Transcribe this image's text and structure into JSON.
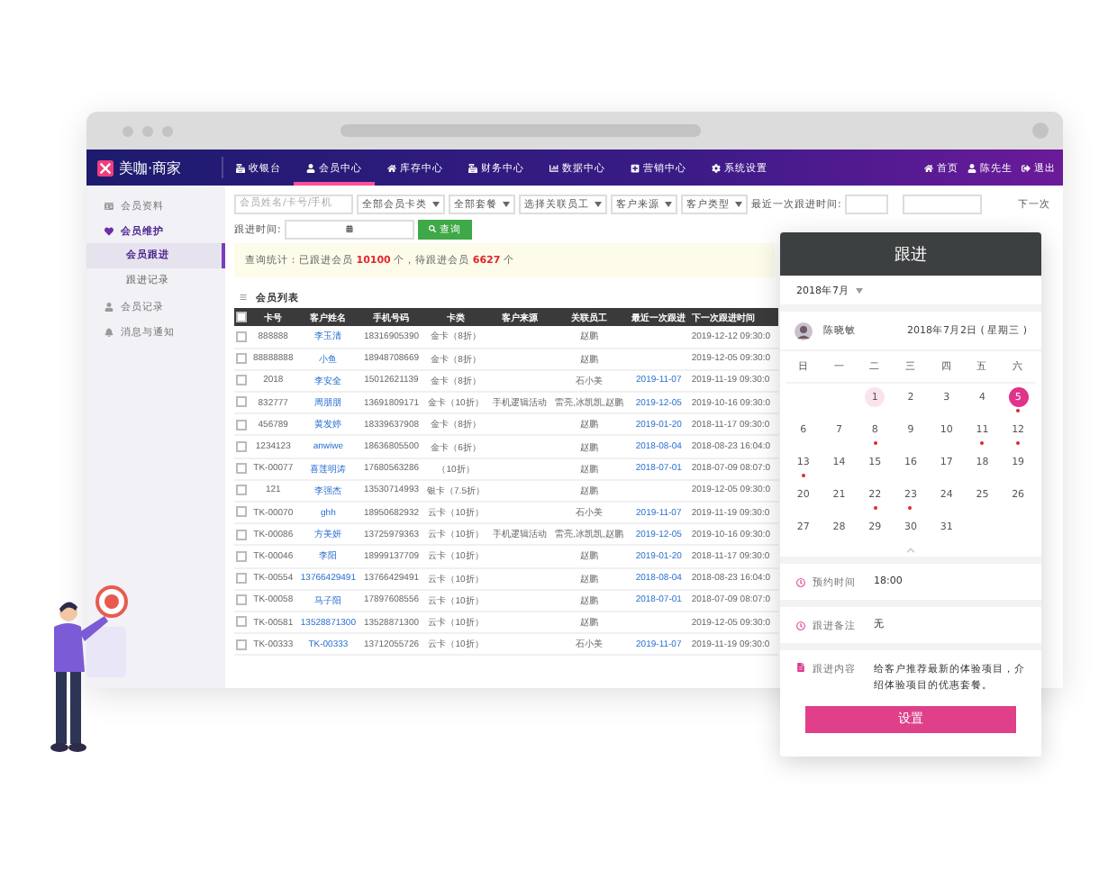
{
  "logo": {
    "brand": "美咖",
    "suffix": "·商家"
  },
  "nav": [
    {
      "label": "收银台",
      "selected": false
    },
    {
      "label": "会员中心",
      "selected": true
    },
    {
      "label": "库存中心",
      "selected": false
    },
    {
      "label": "财务中心",
      "selected": false
    },
    {
      "label": "数据中心",
      "selected": false
    },
    {
      "label": "营销中心",
      "selected": false
    },
    {
      "label": "系统设置",
      "selected": false
    }
  ],
  "nav_right": [
    "首页",
    "陈先生",
    "退出"
  ],
  "sidebar": [
    {
      "label": "会员资料",
      "expanded": false
    },
    {
      "label": "会员维护",
      "expanded": true,
      "children": [
        {
          "label": "会员跟进",
          "selected": true
        },
        {
          "label": "跟进记录",
          "selected": false
        }
      ]
    },
    {
      "label": "会员记录",
      "expanded": false
    },
    {
      "label": "消息与通知",
      "expanded": false
    }
  ],
  "filters": {
    "search": {
      "placeholder": "会员姓名/卡号/手机"
    },
    "selects": [
      "全部会员卡类",
      "全部套餐",
      "选择关联员工",
      "客户来源",
      "客户类型"
    ],
    "last_label": "最近一次跟进时间:",
    "next_label": "下一次",
    "follow_label": "跟进时间:",
    "query_button": "查询"
  },
  "stats": "查询统计：已跟进会员 **10100** 个，待跟进会员 **6627** 个",
  "table": {
    "title": "会员列表",
    "all_checked": false,
    "columns": [
      "卡号",
      "客户姓名",
      "手机号码",
      "卡类",
      "客户来源",
      "关联员工",
      "最近一次跟进",
      "下一次跟进时间"
    ],
    "rows": [
      {
        "checked": false,
        "cells": [
          "888888",
          "李玉清",
          "18316905390",
          "金卡（8折）",
          "",
          "赵鹏",
          "",
          "2019-12-12 09:30:0"
        ]
      },
      {
        "checked": false,
        "cells": [
          "88888888",
          "小鱼",
          "18948708669",
          "金卡（8折）",
          "",
          "赵鹏",
          "",
          "2019-12-05 09:30:0"
        ]
      },
      {
        "checked": false,
        "cells": [
          "2018",
          "李安全",
          "15012621139",
          "金卡（8折）",
          "",
          "石小美",
          "2019-11-07",
          "2019-11-19 09:30:0"
        ]
      },
      {
        "checked": false,
        "cells": [
          "832777",
          "周朋朋",
          "13691809171",
          "金卡（10折）",
          "手机逻辑活动",
          "雷亮,冰凯凯,赵鹏",
          "2019-12-05",
          "2019-10-16 09:30:0"
        ]
      },
      {
        "checked": false,
        "cells": [
          "456789",
          "黄发婷",
          "18339637908",
          "金卡（8折）",
          "",
          "赵鹏",
          "2019-01-20",
          "2018-11-17 09:30:0"
        ]
      },
      {
        "checked": false,
        "cells": [
          "1234123",
          "anwiwe",
          "18636805500",
          "金卡（6折）",
          "",
          "赵鹏",
          "2018-08-04",
          "2018-08-23 16:04:0"
        ]
      },
      {
        "checked": false,
        "cells": [
          "TK-00077",
          "喜莲明涛",
          "17680563286",
          "（10折）",
          "",
          "赵鹏",
          "2018-07-01",
          "2018-07-09 08:07:0"
        ]
      },
      {
        "checked": false,
        "cells": [
          "121",
          "李强杰",
          "13530714993",
          "银卡（7.5折）",
          "",
          "赵鹏",
          "",
          "2019-12-05 09:30:0"
        ]
      },
      {
        "checked": false,
        "cells": [
          "TK-00070",
          "ghh",
          "18950682932",
          "云卡（10折）",
          "",
          "石小美",
          "2019-11-07",
          "2019-11-19 09:30:0"
        ]
      },
      {
        "checked": false,
        "cells": [
          "TK-00086",
          "方美妍",
          "13725979363",
          "云卡（10折）",
          "手机逻辑活动",
          "雷亮,冰凯凯,赵鹏",
          "2019-12-05",
          "2019-10-16 09:30:0"
        ]
      },
      {
        "checked": false,
        "cells": [
          "TK-00046",
          "李阳",
          "18999137709",
          "云卡（10折）",
          "",
          "赵鹏",
          "2019-01-20",
          "2018-11-17 09:30:0"
        ]
      },
      {
        "checked": false,
        "cells": [
          "TK-00554",
          "13766429491",
          "13766429491",
          "云卡（10折）",
          "",
          "赵鹏",
          "2018-08-04",
          "2018-08-23 16:04:0"
        ]
      },
      {
        "checked": false,
        "cells": [
          "TK-00058",
          "马子阳",
          "17897608556",
          "云卡（10折）",
          "",
          "赵鹏",
          "2018-07-01",
          "2018-07-09 08:07:0"
        ]
      },
      {
        "checked": false,
        "cells": [
          "TK-00581",
          "13528871300",
          "13528871300",
          "云卡（10折）",
          "",
          "赵鹏",
          "",
          "2019-12-05 09:30:0"
        ]
      },
      {
        "checked": false,
        "cells": [
          "TK-00333",
          "TK-00333",
          "13712055726",
          "云卡（10折）",
          "",
          "石小美",
          "2019-11-07",
          "2019-11-19 09:30:0"
        ]
      }
    ]
  },
  "panel": {
    "title": "跟进",
    "month": "2018年7月",
    "person": "陈晓敏",
    "date": "2018年7月2日 ( 星期三 )",
    "weekdays": [
      "日",
      "一",
      "二",
      "三",
      "四",
      "五",
      "六"
    ],
    "days": [
      {
        "kind": "blank"
      },
      {
        "kind": "blank"
      },
      {
        "kind": "day",
        "label": "1",
        "selected": false,
        "today": true,
        "marked": false
      },
      {
        "kind": "day",
        "label": "2",
        "selected": false,
        "today": false,
        "marked": false
      },
      {
        "kind": "day",
        "label": "3",
        "selected": false,
        "today": false,
        "marked": false
      },
      {
        "kind": "day",
        "label": "4",
        "selected": false,
        "today": false,
        "marked": false
      },
      {
        "kind": "day",
        "label": "5",
        "selected": true,
        "today": false,
        "marked": true
      },
      {
        "kind": "day",
        "label": "6",
        "selected": false,
        "today": false,
        "marked": false
      },
      {
        "kind": "day",
        "label": "7",
        "selected": false,
        "today": false,
        "marked": false
      },
      {
        "kind": "day",
        "label": "8",
        "selected": false,
        "today": false,
        "marked": true
      },
      {
        "kind": "day",
        "label": "9",
        "selected": false,
        "today": false,
        "marked": false
      },
      {
        "kind": "day",
        "label": "10",
        "selected": false,
        "today": false,
        "marked": false
      },
      {
        "kind": "day",
        "label": "11",
        "selected": false,
        "today": false,
        "marked": true
      },
      {
        "kind": "day",
        "label": "12",
        "selected": false,
        "today": false,
        "marked": true
      },
      {
        "kind": "day",
        "label": "13",
        "selected": false,
        "today": false,
        "marked": true
      },
      {
        "kind": "day",
        "label": "14",
        "selected": false,
        "today": false,
        "marked": false
      },
      {
        "kind": "day",
        "label": "15",
        "selected": false,
        "today": false,
        "marked": false
      },
      {
        "kind": "day",
        "label": "16",
        "selected": false,
        "today": false,
        "marked": false
      },
      {
        "kind": "day",
        "label": "17",
        "selected": false,
        "today": false,
        "marked": false
      },
      {
        "kind": "day",
        "label": "18",
        "selected": false,
        "today": false,
        "marked": false
      },
      {
        "kind": "day",
        "label": "19",
        "selected": false,
        "today": false,
        "marked": false
      },
      {
        "kind": "day",
        "label": "20",
        "selected": false,
        "today": false,
        "marked": false
      },
      {
        "kind": "day",
        "label": "21",
        "selected": false,
        "today": false,
        "marked": false
      },
      {
        "kind": "day",
        "label": "22",
        "selected": false,
        "today": false,
        "marked": true
      },
      {
        "kind": "day",
        "label": "23",
        "selected": false,
        "today": false,
        "marked": true
      },
      {
        "kind": "day",
        "label": "24",
        "selected": false,
        "today": false,
        "marked": false
      },
      {
        "kind": "day",
        "label": "25",
        "selected": false,
        "today": false,
        "marked": false
      },
      {
        "kind": "day",
        "label": "26",
        "selected": false,
        "today": false,
        "marked": false
      },
      {
        "kind": "day",
        "label": "27",
        "selected": false,
        "today": false,
        "marked": false
      },
      {
        "kind": "day",
        "label": "28",
        "selected": false,
        "today": false,
        "marked": false
      },
      {
        "kind": "day",
        "label": "29",
        "selected": false,
        "today": false,
        "marked": false
      },
      {
        "kind": "day",
        "label": "30",
        "selected": false,
        "today": false,
        "marked": false
      },
      {
        "kind": "day",
        "label": "31",
        "selected": false,
        "today": false,
        "marked": false
      }
    ],
    "fields": [
      {
        "label": "预约时间",
        "value": "18:00"
      },
      {
        "label": "跟进备注",
        "value": "无"
      },
      {
        "label": "跟进内容",
        "value": "给客户推荐最新的体验项目，介绍体验项目的优惠套餐。"
      }
    ],
    "button": "设置"
  }
}
